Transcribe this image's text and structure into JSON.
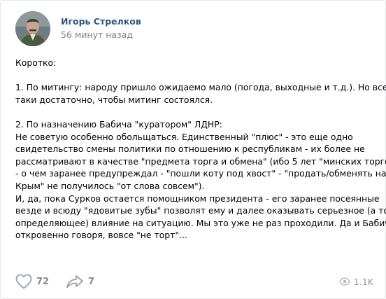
{
  "post": {
    "author": "Игорь Стрелков",
    "time": "56 минут назад",
    "avatar_icon": "user-photo",
    "lines": [
      "Коротко:",
      "",
      "1. По митингу: народу пришло ожидаемо мало (погода, выходные и т.д.). Но все-",
      "таки достаточно, чтобы митинг состоялся.",
      "",
      "2. По назначению Бабича \"куратором\" ЛДНР:",
      "Не советую особенно обольщаться. Единственный \"плюс\" - это еще одно",
      "свидетельство смены политики по отношению к республикам - их более не",
      "рассматривают в качестве \"предмета торга и обмена\" (ибо 5 лет \"минских торгов\"",
      "- о чем заранее предупреждал - \"пошли коту под хвост\" - \"продать/обменять на",
      "Крым\" не получилось \"от слова совсем\").",
      "И, да, пока Сурков остается помощником президента - его заранее посеянные",
      "везде и всюду \"ядовитые зубы\" позволят ему и далее оказывать серьезное (а то и",
      "определяющее) влияние на ситуацию. Мы это уже не раз проходили. Да и Бабич,",
      "откровенно говоря, вовсе \"не торт\"..."
    ]
  },
  "footer": {
    "likes": "72",
    "shares": "7",
    "views": "1.1K",
    "like_icon": "heart-icon",
    "share_icon": "share-arrow-icon",
    "views_icon": "eye-icon"
  },
  "colors": {
    "author": "#2a5885",
    "meta": "#828282",
    "icon": "#99a2ad",
    "border": "#e7e8ec"
  }
}
